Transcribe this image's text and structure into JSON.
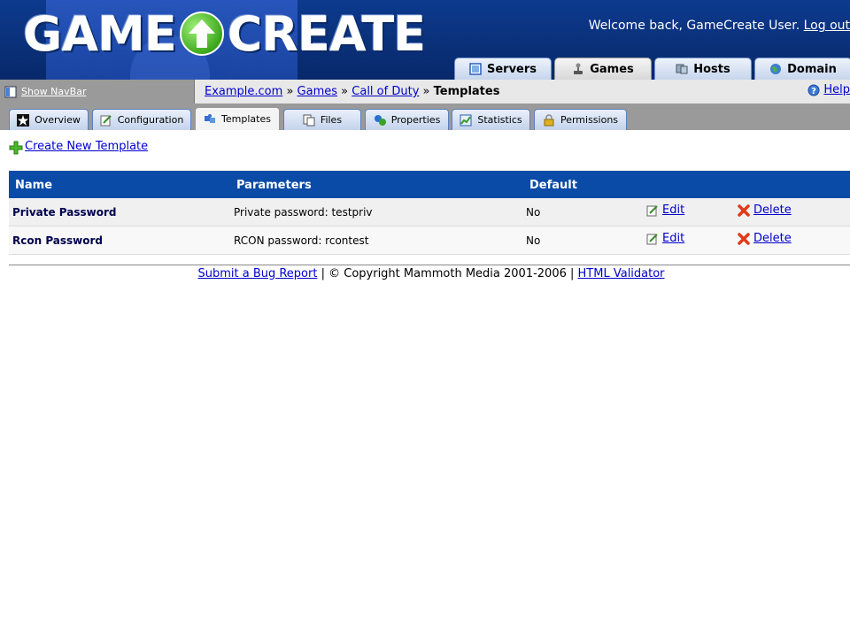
{
  "header": {
    "logo_left": "GAME",
    "logo_right": "CREATE",
    "welcome_text": "Welcome back, GameCreate User.",
    "logout_label": "Log out"
  },
  "top_tabs": [
    {
      "label": "Servers",
      "icon": "server-icon",
      "active": false
    },
    {
      "label": "Games",
      "icon": "joystick-icon",
      "active": true
    },
    {
      "label": "Hosts",
      "icon": "host-icon",
      "active": false
    },
    {
      "label": "Domain",
      "icon": "globe-icon",
      "active": false
    }
  ],
  "navbar": {
    "toggle_label": "Show NavBar"
  },
  "breadcrumb": {
    "items": [
      "Example.com",
      "Games",
      "Call of Duty"
    ],
    "separator": "»",
    "current": "Templates"
  },
  "help_label": "Help",
  "sub_tabs": [
    {
      "label": "Overview",
      "icon": "star-icon",
      "active": false
    },
    {
      "label": "Configuration",
      "icon": "edit-icon",
      "active": false
    },
    {
      "label": "Templates",
      "icon": "puzzle-icon",
      "active": true
    },
    {
      "label": "Files",
      "icon": "files-icon",
      "active": false
    },
    {
      "label": "Properties",
      "icon": "properties-icon",
      "active": false
    },
    {
      "label": "Statistics",
      "icon": "chart-icon",
      "active": false
    },
    {
      "label": "Permissions",
      "icon": "lock-icon",
      "active": false
    }
  ],
  "create_link": "Create New Template",
  "table": {
    "headers": [
      "Name",
      "Parameters",
      "Default"
    ],
    "rows": [
      {
        "name": "Private Password",
        "parameters": "Private password: testpriv",
        "default": "No",
        "edit": "Edit",
        "delete": "Delete"
      },
      {
        "name": "Rcon Password",
        "parameters": "RCON password: rcontest",
        "default": "No",
        "edit": "Edit",
        "delete": "Delete"
      }
    ]
  },
  "footer": {
    "bug_report": "Submit a Bug Report",
    "sep1": " | ",
    "copyright": "© Copyright Mammoth Media 2001-2006",
    "sep2": " | ",
    "validator": "HTML Validator"
  },
  "colors": {
    "header_blue": "#0a3078",
    "table_header": "#0a4ba8",
    "link": "#0000cc"
  }
}
